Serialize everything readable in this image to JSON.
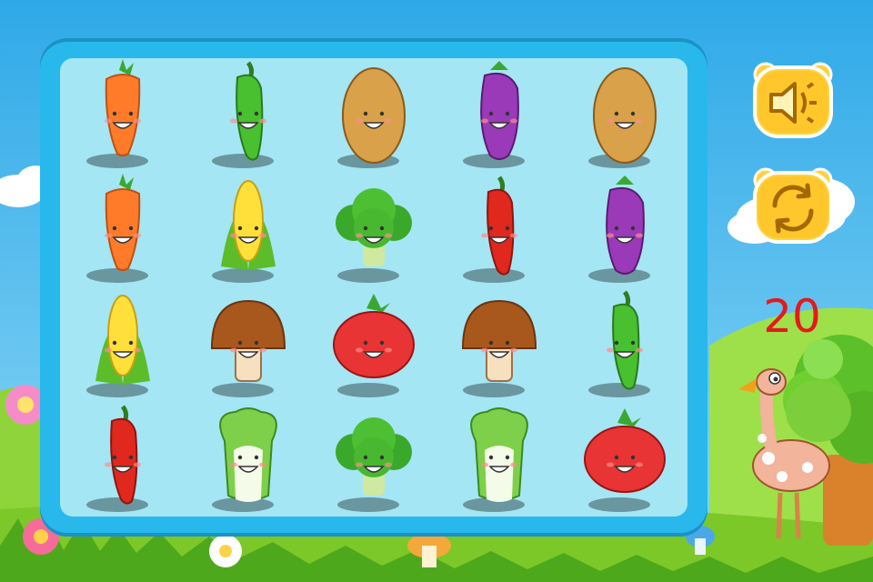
{
  "game": {
    "score": "20",
    "buttons": [
      {
        "name": "sound-button",
        "icon": "speaker-icon"
      },
      {
        "name": "shuffle-button",
        "icon": "refresh-icon"
      }
    ]
  },
  "board": {
    "rows": 4,
    "cols": 5,
    "tiles": [
      [
        "carrot",
        "green-pepper",
        "potato",
        "eggplant",
        "potato"
      ],
      [
        "carrot",
        "corn",
        "broccoli",
        "red-pepper",
        "eggplant"
      ],
      [
        "corn",
        "mushroom",
        "tomato",
        "mushroom",
        "green-pepper"
      ],
      [
        "red-pepper",
        "cabbage",
        "broccoli",
        "cabbage",
        "tomato"
      ]
    ]
  },
  "colors": {
    "sky": "#48bff0",
    "grass": "#86d02c",
    "board_frame": "#28b8ec",
    "board_fill": "#a4e6f4",
    "button_yellow": "#ffd23e",
    "score": "#e41a1a"
  }
}
